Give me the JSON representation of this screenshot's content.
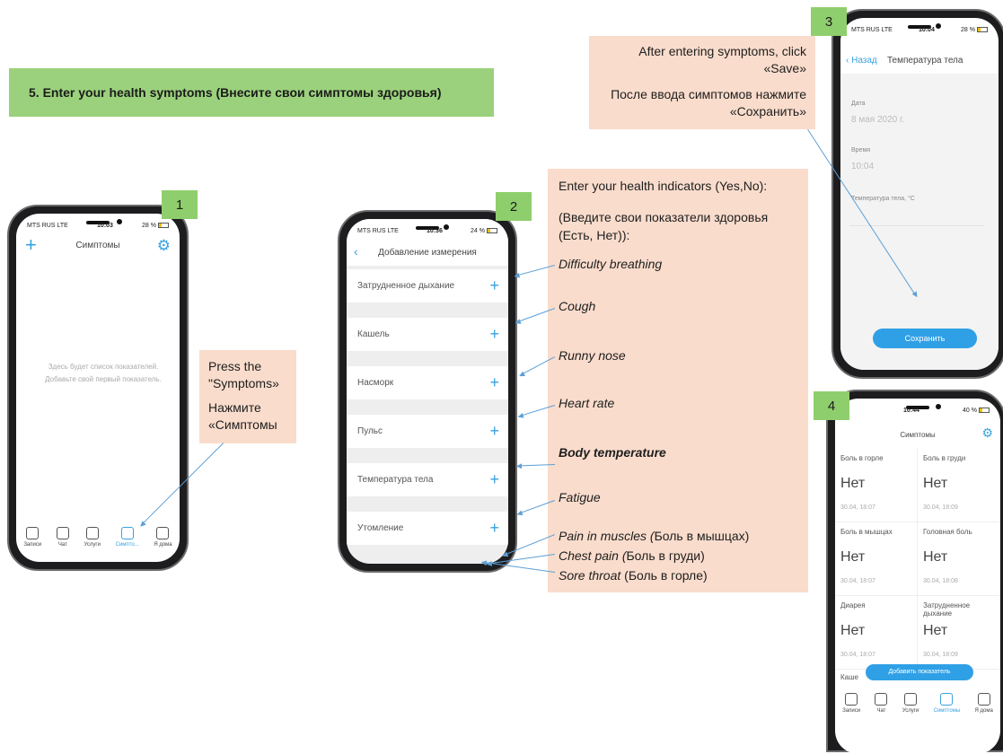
{
  "step_title": "5.  Enter your health symptoms  (Внесите свои симптомы здоровья)",
  "badges": [
    "1",
    "2",
    "3",
    "4"
  ],
  "note1": {
    "en": "Press the \"Symptoms»",
    "ru": "Нажмите «Симптомы"
  },
  "note2": {
    "en": "Enter your health indicators (Yes,No):",
    "ru": "(Введите свои показатели здоровья (Есть, Нет)):",
    "items": [
      "Difficulty breathing",
      "Cough",
      "Runny nose",
      "Heart rate",
      "Body temperature",
      "Fatigue"
    ],
    "extra": [
      {
        "en": "Pain in muscles (",
        "ru": "Боль в мышцах)"
      },
      {
        "en": "Chest pain (",
        "ru": "Боль в груди)"
      },
      {
        "en": "Sore throat ",
        "ru": "(Боль в горле)"
      }
    ]
  },
  "note3": {
    "en": "After entering symptoms, click «Save»",
    "ru": "После ввода симптомов нажмите «Сохранить»"
  },
  "phone1": {
    "carrier": "MTS RUS  LTE",
    "time": "10:03",
    "battery": "28 %",
    "title": "Симптомы",
    "empty_text": "Здесь будет список показателей. Добавьте свой первый показатель.",
    "tabs": [
      "Записи",
      "Чат",
      "Услуги",
      "Симпто...",
      "Я дома"
    ]
  },
  "phone2": {
    "carrier": "MTS RUS  LTE",
    "time": "10:36",
    "battery": "24 %",
    "title": "Добавление измерения",
    "rows": [
      "Затрудненное дыхание",
      "Кашель",
      "Насморк",
      "Пульс",
      "Температура тела",
      "Утомление"
    ]
  },
  "phone3": {
    "carrier": "MTS RUS  LTE",
    "time": "10:04",
    "battery": "28 %",
    "back": "Назад",
    "title": "Температура тела",
    "date_label": "Дата",
    "date_value": "8 мая 2020 г.",
    "time_label": "Время",
    "time_value": "10:04",
    "temp_label": "Температура тела, °С",
    "save": "Сохранить"
  },
  "phone4": {
    "time": "10:44",
    "battery": "40 %",
    "title": "Симптомы",
    "cells": [
      {
        "name": "Боль в горле",
        "value": "Нет",
        "date": "30.04, 18:07"
      },
      {
        "name": "Боль в груди",
        "value": "Нет",
        "date": "30.04, 18:09"
      },
      {
        "name": "Боль в мышцах",
        "value": "Нет",
        "date": "30.04, 18:07"
      },
      {
        "name": "Головная боль",
        "value": "Нет",
        "date": "30.04, 18:08"
      },
      {
        "name": "Диарея",
        "value": "Нет",
        "date": "30.04, 18:07"
      },
      {
        "name": "Затрудненное дыхание",
        "value": "Нет",
        "date": "30.04, 18:09"
      }
    ],
    "partial": "Каше",
    "add_button": "Добавить показатель",
    "tabs": [
      "Записи",
      "Чат",
      "Услуги",
      "Симптомы",
      "Я дома"
    ]
  }
}
